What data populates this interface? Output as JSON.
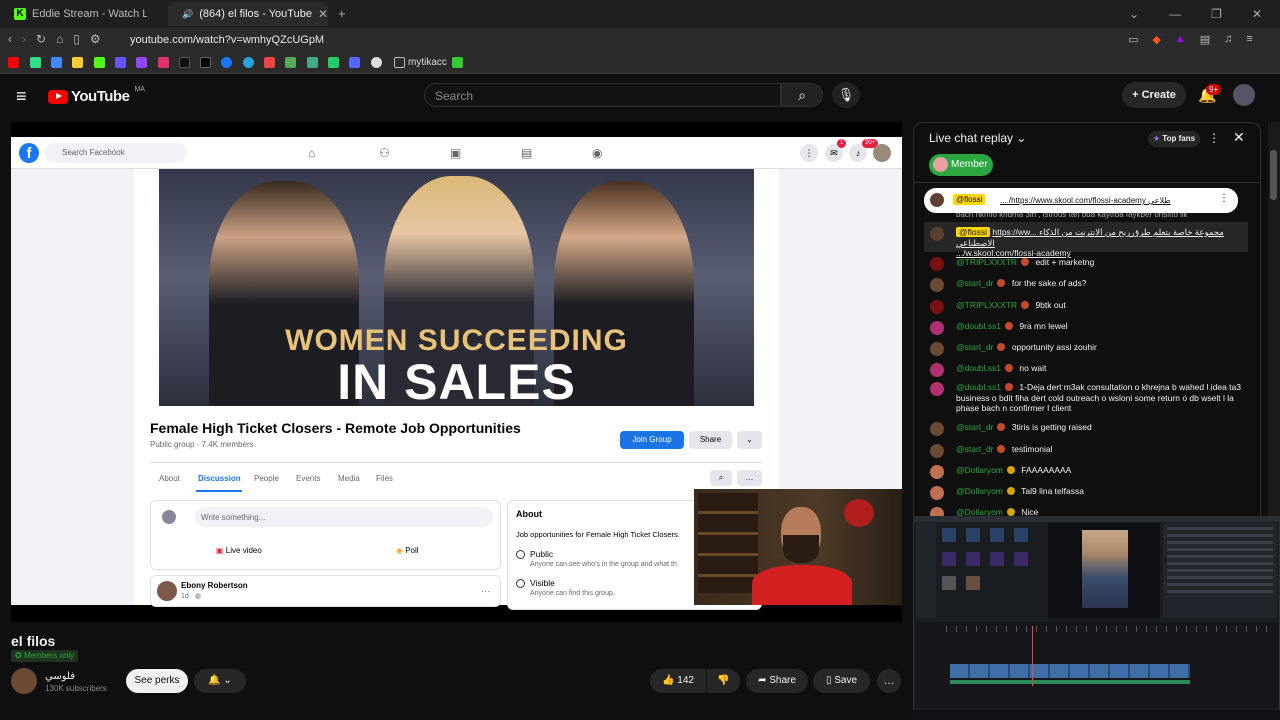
{
  "browser": {
    "tabs": [
      {
        "label": "Eddie Stream - Watch Live on Kick",
        "icon": "kick-icon"
      },
      {
        "label": "(864) el filos - YouTube",
        "icon": "youtube-icon",
        "audio": true
      }
    ],
    "url": "youtube.com/watch?v=wmhyQZcUGpM",
    "bookmark_folder": "mytikacc"
  },
  "youtube": {
    "logo": "YouTube",
    "country": "MA",
    "search_placeholder": "Search",
    "create_label": "Create",
    "notif_count": "9+"
  },
  "facebook": {
    "search_placeholder": "Search Facebook",
    "messenger_badge": "1",
    "notif_badge": "20+",
    "cover_line1": "WOMEN SUCCEEDING",
    "cover_line2": "IN SALES",
    "group_title": "Female High Ticket Closers - Remote Job Opportunities",
    "group_meta": "Public group · 7.4K members",
    "join_label": "Join Group",
    "share_label": "Share",
    "tabs": [
      "About",
      "Discussion",
      "People",
      "Events",
      "Media",
      "Files"
    ],
    "compose_placeholder": "Write something...",
    "live_video": "Live video",
    "poll": "Poll",
    "post_author": "Ebony Robertson",
    "post_time": "1d",
    "about_title": "About",
    "about_desc": "Job opportunities for Female High Ticket Closers.",
    "public_title": "Public",
    "public_desc": "Anyone can see who's in the group and what th",
    "visible_title": "Visible",
    "visible_desc": "Anyone can find this group."
  },
  "video": {
    "title": "el filos",
    "members_only": "Members only",
    "channel_name": "فلوسي",
    "subscribers": "130K subscribers",
    "see_perks": "See perks",
    "likes": "142",
    "share": "Share",
    "save": "Save"
  },
  "chat": {
    "title": "Live chat replay",
    "top_fans": "Top fans",
    "member_filter": "Member",
    "pinned_tag": "@flossi",
    "pinned_text": "..../https://www.skool.com/flossi-academy طلاعي",
    "pinned_behind": "bach nkmlo khdma 3ih , istrous fah bda kaytrba faykber onsifto lik",
    "messages": [
      {
        "name": "@flossi",
        "tag": true,
        "text": "https://ww... مجموعة خاصة بتعلم طرق ربح من الانترنت من الذكاء الاصطناعي",
        "text2": ".../w.skool.com/flossi-academy",
        "badge": "",
        "avatar": "#5a4030"
      },
      {
        "name": "@TRIPLXXXTR",
        "text": "edit + marketng",
        "badge": "red",
        "avatar": "#7a1010"
      },
      {
        "name": "@start_dr",
        "text": "for the sake of ads?",
        "badge": "red",
        "avatar": "#6b4a35"
      },
      {
        "name": "@TRIPLXXXTR",
        "text": "9btk out",
        "badge": "red",
        "avatar": "#7a1010"
      },
      {
        "name": "@doubl.ss1",
        "text": "9ra mn lewel",
        "badge": "red",
        "avatar": "#b03070"
      },
      {
        "name": "@start_dr",
        "text": "opportunity assi zouhir",
        "badge": "red",
        "avatar": "#6b4a35"
      },
      {
        "name": "@doubl.ss1",
        "text": "no wait",
        "badge": "red",
        "avatar": "#b03070"
      },
      {
        "name": "@doubl.ss1",
        "text": "1-Deja dert m3ak consultation o khrejna b wahed l idea ta3 business o bdit fiha dert cold outreach o wsloni some return o db wselt l la phase bach n confirmer l client",
        "badge": "red",
        "avatar": "#b03070"
      },
      {
        "name": "@start_dr",
        "text": "3tiris is getting raised",
        "badge": "red",
        "avatar": "#6b4a35"
      },
      {
        "name": "@start_dr",
        "text": "testimonial",
        "badge": "red",
        "avatar": "#6b4a35"
      },
      {
        "name": "@Dollaryom",
        "text": "FAAAAAAAA",
        "badge": "gold",
        "avatar": "#c07050"
      },
      {
        "name": "@Dollaryom",
        "text": "Tal9 lina telfassa",
        "badge": "gold",
        "avatar": "#c07050"
      },
      {
        "name": "@Dollaryom",
        "text": "Nice",
        "badge": "gold",
        "avatar": "#c07050"
      }
    ]
  }
}
